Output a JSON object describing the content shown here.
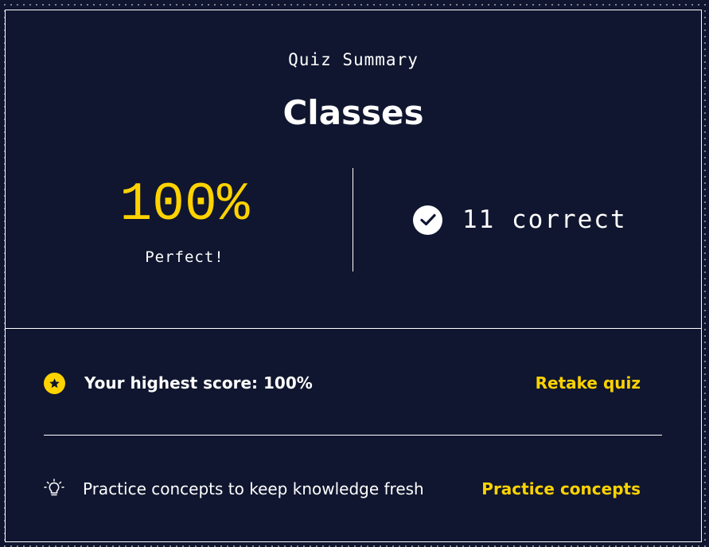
{
  "summary": {
    "eyebrow": "Quiz Summary",
    "title": "Classes"
  },
  "score": {
    "percent": "100%",
    "message": "Perfect!",
    "correct": "11 correct"
  },
  "highest": {
    "label": "Your highest score: 100%",
    "action": "Retake quiz"
  },
  "practice": {
    "label": "Practice concepts to keep knowledge fresh",
    "action": "Practice concepts"
  },
  "icons": {
    "check": "check-circle-icon",
    "star": "star-badge-icon",
    "bulb": "lightbulb-icon"
  },
  "colors": {
    "background": "#10162f",
    "accent": "#ffd300",
    "text": "#ffffff"
  }
}
